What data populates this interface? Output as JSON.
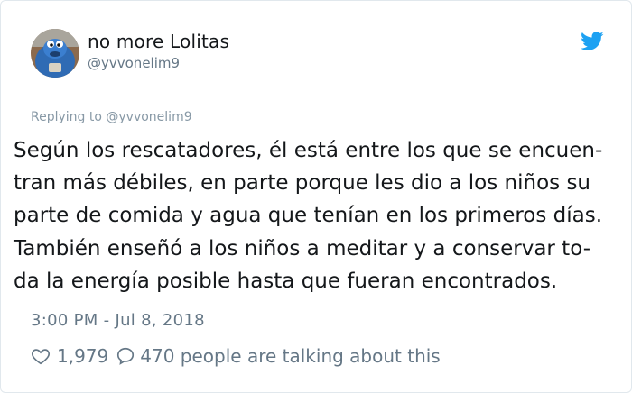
{
  "tweet": {
    "display_name": "no more Lolitas",
    "handle": "@yvvonelim9",
    "replying_to": "Replying to @yvvonelim9",
    "lines": [
      "Según los rescatadores, él está entre los que se encuen-",
      "tran más débiles, en parte porque les dio a los niños su",
      "parte de comida y agua que tenían en los primeros días.",
      "También enseñó a los niños a meditar y a conservar to-",
      "da la energía posible hasta que fueran encontrados."
    ],
    "timestamp": "3:00 PM - Jul 8, 2018",
    "like_count": "1,979",
    "talking_text": "470 people are talking about this"
  },
  "colors": {
    "twitter_blue": "#1da1f2",
    "secondary_text": "#657786",
    "primary_text": "#14171a"
  },
  "icons": {
    "brand": "twitter-bird-icon",
    "like": "heart-icon",
    "reply": "speech-bubble-icon",
    "avatar": "blue-furry-character-avatar"
  }
}
